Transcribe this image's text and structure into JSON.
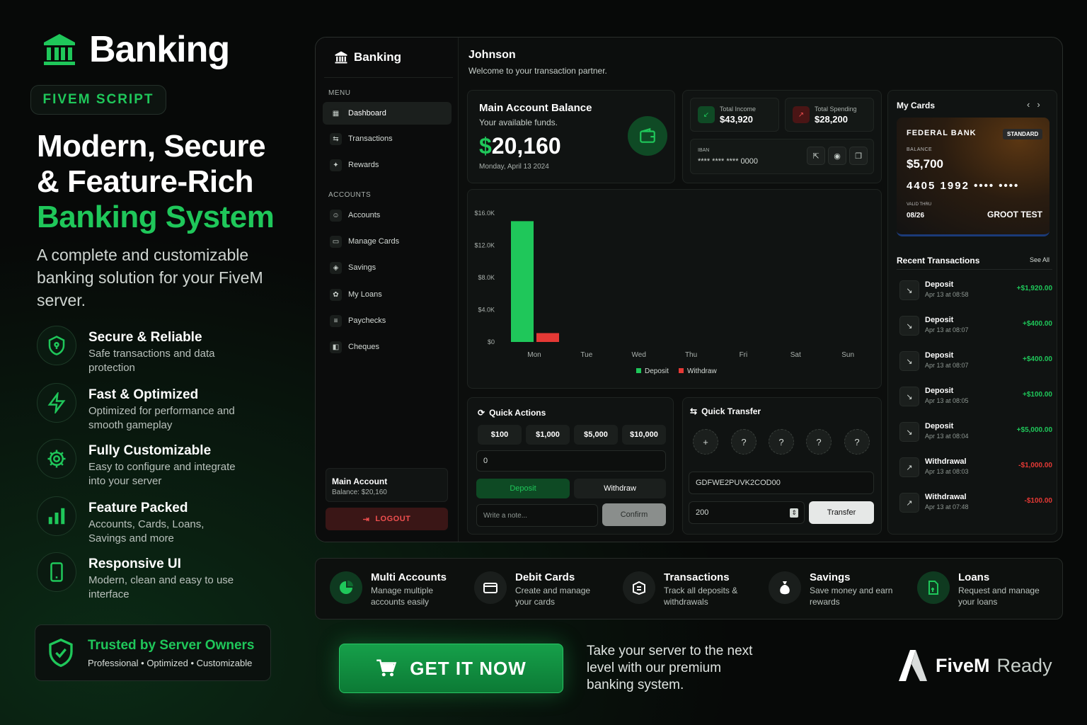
{
  "brand": {
    "name": "Banking",
    "badge": "FIVEM SCRIPT"
  },
  "headline": {
    "line1": "Modern, Secure",
    "line2": "& Feature-Rich",
    "line3": "Banking System"
  },
  "subtitle": "A complete and customizable banking solution for your FiveM server.",
  "features": [
    {
      "title": "Secure & Reliable",
      "desc": "Safe transactions and data protection",
      "icon": "shield-icon"
    },
    {
      "title": "Fast & Optimized",
      "desc": "Optimized for performance and smooth gameplay",
      "icon": "lightning-icon"
    },
    {
      "title": "Fully Customizable",
      "desc": "Easy to configure and integrate into your server",
      "icon": "gear-icon"
    },
    {
      "title": "Feature Packed",
      "desc": "Accounts, Cards, Loans, Savings and more",
      "icon": "bar-chart-icon"
    },
    {
      "title": "Responsive UI",
      "desc": "Modern, clean and easy to use interface",
      "icon": "phone-icon"
    }
  ],
  "trusted": {
    "title": "Trusted by Server Owners",
    "desc": "Professional • Optimized • Customizable"
  },
  "dashboard": {
    "brand": "Banking",
    "menu_label": "MENU",
    "menu": [
      "Dashboard",
      "Transactions",
      "Rewards"
    ],
    "accounts_label": "ACCOUNTS",
    "accounts": [
      "Accounts",
      "Manage Cards",
      "Savings",
      "My Loans",
      "Paychecks",
      "Cheques"
    ],
    "main_account": {
      "title": "Main Account",
      "balance": "Balance: $20,160"
    },
    "logout": "LOGOUT",
    "user": "Johnson",
    "welcome": "Welcome to your transaction partner.",
    "balance_card": {
      "title": "Main Account Balance",
      "sub": "Your available funds.",
      "currency": "$",
      "amount": "20,160",
      "date": "Monday, April 13 2024"
    },
    "income": {
      "label": "Total Income",
      "value": "$43,920"
    },
    "spending": {
      "label": "Total Spending",
      "value": "$28,200"
    },
    "iban": {
      "label": "IBAN",
      "value": "**** **** **** 0000"
    },
    "quick_actions": {
      "title": "Quick Actions",
      "amounts": [
        "$100",
        "$1,000",
        "$5,000",
        "$10,000"
      ],
      "amount_value": "0",
      "deposit": "Deposit",
      "withdraw": "Withdraw",
      "note_placeholder": "Write a note...",
      "confirm": "Confirm"
    },
    "quick_transfer": {
      "title": "Quick Transfer",
      "contacts": [
        "+",
        "?",
        "?",
        "?",
        "?"
      ],
      "account_value": "GDFWE2PUVK2COD00",
      "amount_value": "200",
      "transfer": "Transfer"
    },
    "my_cards": {
      "title": "My Cards",
      "bank": "FEDERAL BANK",
      "tier": "STANDARD",
      "balance_label": "BALANCE",
      "balance": "$5,700",
      "number": "4405 1992 •••• ••••",
      "valid_label": "VALID THRU",
      "valid": "08/26",
      "holder": "GROOT TEST"
    },
    "recent": {
      "title": "Recent Transactions",
      "see_all": "See All",
      "items": [
        {
          "name": "Deposit",
          "time": "Apr 13 at 08:58",
          "amount": "+$1,920.00",
          "type": "in"
        },
        {
          "name": "Deposit",
          "time": "Apr 13 at 08:07",
          "amount": "+$400.00",
          "type": "in"
        },
        {
          "name": "Deposit",
          "time": "Apr 13 at 08:07",
          "amount": "+$400.00",
          "type": "in"
        },
        {
          "name": "Deposit",
          "time": "Apr 13 at 08:05",
          "amount": "+$100.00",
          "type": "in"
        },
        {
          "name": "Deposit",
          "time": "Apr 13 at 08:04",
          "amount": "+$5,000.00",
          "type": "in"
        },
        {
          "name": "Withdrawal",
          "time": "Apr 13 at 08:03",
          "amount": "-$1,000.00",
          "type": "out"
        },
        {
          "name": "Withdrawal",
          "time": "Apr 13 at 07:48",
          "amount": "-$100.00",
          "type": "out"
        }
      ]
    }
  },
  "chart_data": {
    "type": "bar",
    "categories": [
      "Mon",
      "Tue",
      "Wed",
      "Thu",
      "Fri",
      "Sat",
      "Sun"
    ],
    "series": [
      {
        "name": "Deposit",
        "values": [
          15000,
          0,
          0,
          0,
          0,
          0,
          0
        ],
        "color": "#1fc75a"
      },
      {
        "name": "Withdraw",
        "values": [
          1100,
          0,
          0,
          0,
          0,
          0,
          0
        ],
        "color": "#e53935"
      }
    ],
    "yticks": [
      "$0",
      "$4.0K",
      "$8.0K",
      "$12.0K",
      "$16.0K"
    ],
    "ylim": [
      0,
      16000
    ],
    "legend": "bottom-center",
    "grid": false
  },
  "strip": [
    {
      "title": "Multi Accounts",
      "desc": "Manage multiple accounts easily",
      "icon": "pie-icon"
    },
    {
      "title": "Debit Cards",
      "desc": "Create and manage your cards",
      "icon": "card-icon"
    },
    {
      "title": "Transactions",
      "desc": "Track all deposits & withdrawals",
      "icon": "box-icon"
    },
    {
      "title": "Savings",
      "desc": "Save money and earn rewards",
      "icon": "money-bag-icon"
    },
    {
      "title": "Loans",
      "desc": "Request and manage your loans",
      "icon": "loan-icon"
    }
  ],
  "cta": {
    "label": "GET IT NOW",
    "tagline": "Take your server to the next level with our premium banking system."
  },
  "fivem": {
    "name": "FiveM",
    "ready": "Ready"
  },
  "colors": {
    "accent": "#1fc75a",
    "danger": "#e53935",
    "bg": "#070908"
  }
}
